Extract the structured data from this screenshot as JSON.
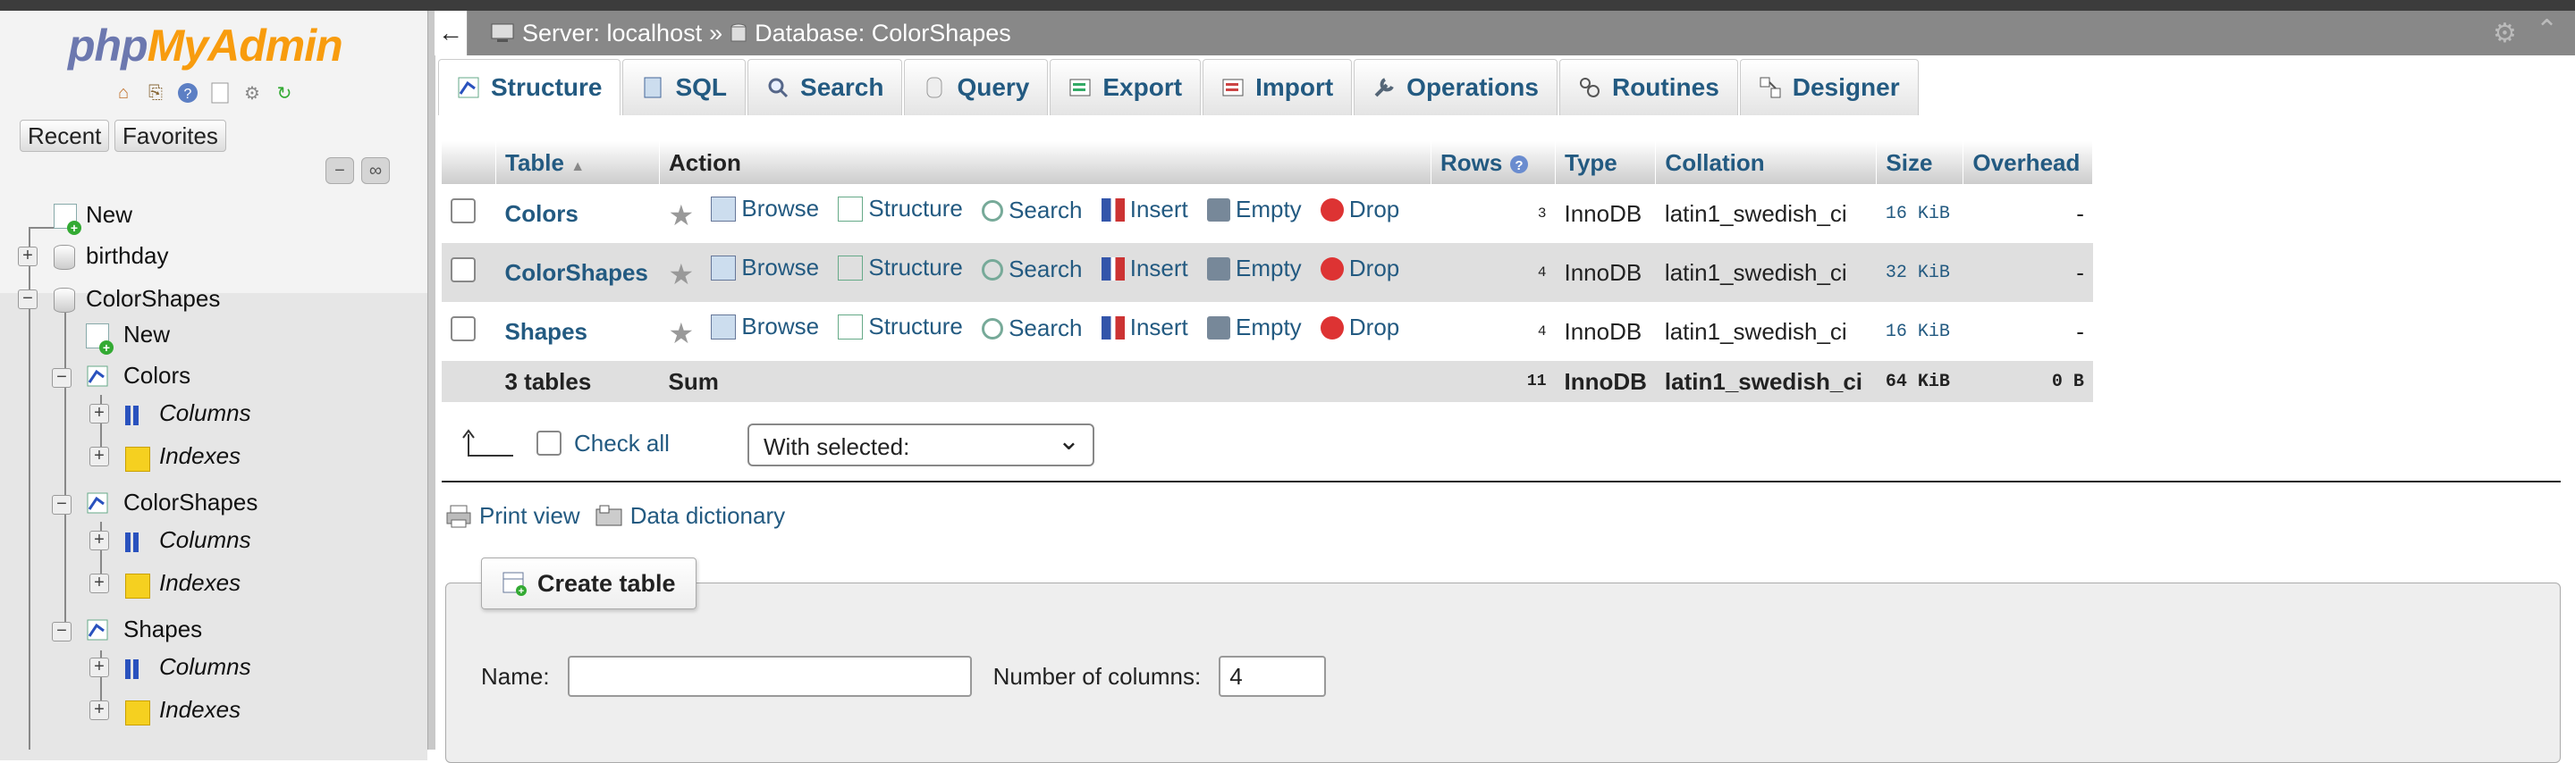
{
  "app": {
    "logo_php": "php",
    "logo_myadmin": "MyAdmin"
  },
  "nav": {
    "recent_label": "Recent",
    "favorites_label": "Favorites",
    "tree": {
      "new_label": "New",
      "birthday": "birthday",
      "colorshapes": "ColorShapes",
      "db_new": "New",
      "colors": "Colors",
      "colors_columns": "Columns",
      "colors_indexes": "Indexes",
      "cs": "ColorShapes",
      "cs_columns": "Columns",
      "cs_indexes": "Indexes",
      "shapes": "Shapes",
      "shapes_columns": "Columns",
      "shapes_indexes": "Indexes"
    }
  },
  "breadcrumb": {
    "server": "Server: localhost",
    "sep": "»",
    "database": "Database: ColorShapes"
  },
  "tabs": [
    "Structure",
    "SQL",
    "Search",
    "Query",
    "Export",
    "Import",
    "Operations",
    "Routines",
    "Designer"
  ],
  "table": {
    "headers": {
      "table": "Table",
      "action": "Action",
      "rows": "Rows",
      "type": "Type",
      "collation": "Collation",
      "size": "Size",
      "overhead": "Overhead"
    },
    "actions": {
      "browse": "Browse",
      "structure": "Structure",
      "search": "Search",
      "insert": "Insert",
      "empty": "Empty",
      "drop": "Drop"
    },
    "rows": [
      {
        "name": "Colors",
        "rows": "3",
        "type": "InnoDB",
        "collation": "latin1_swedish_ci",
        "size": "16 KiB",
        "overhead": "-"
      },
      {
        "name": "ColorShapes",
        "rows": "4",
        "type": "InnoDB",
        "collation": "latin1_swedish_ci",
        "size": "32 KiB",
        "overhead": "-"
      },
      {
        "name": "Shapes",
        "rows": "4",
        "type": "InnoDB",
        "collation": "latin1_swedish_ci",
        "size": "16 KiB",
        "overhead": "-"
      }
    ],
    "footer": {
      "tables": "3 tables",
      "sum": "Sum",
      "rows": "11",
      "type": "InnoDB",
      "collation": "latin1_swedish_ci",
      "size": "64 KiB",
      "overhead": "0 B"
    }
  },
  "bulk": {
    "check_all": "Check all",
    "with_selected": "With selected:"
  },
  "links": {
    "print_view": "Print view",
    "data_dictionary": "Data dictionary"
  },
  "create": {
    "legend": "Create table",
    "name_label": "Name:",
    "name_value": "",
    "cols_label": "Number of columns:",
    "cols_value": "4"
  },
  "colors": {
    "link": "#235a81",
    "logo_php": "#6c78af",
    "logo_myadmin": "#f89c0e",
    "topbar": "#888888"
  }
}
